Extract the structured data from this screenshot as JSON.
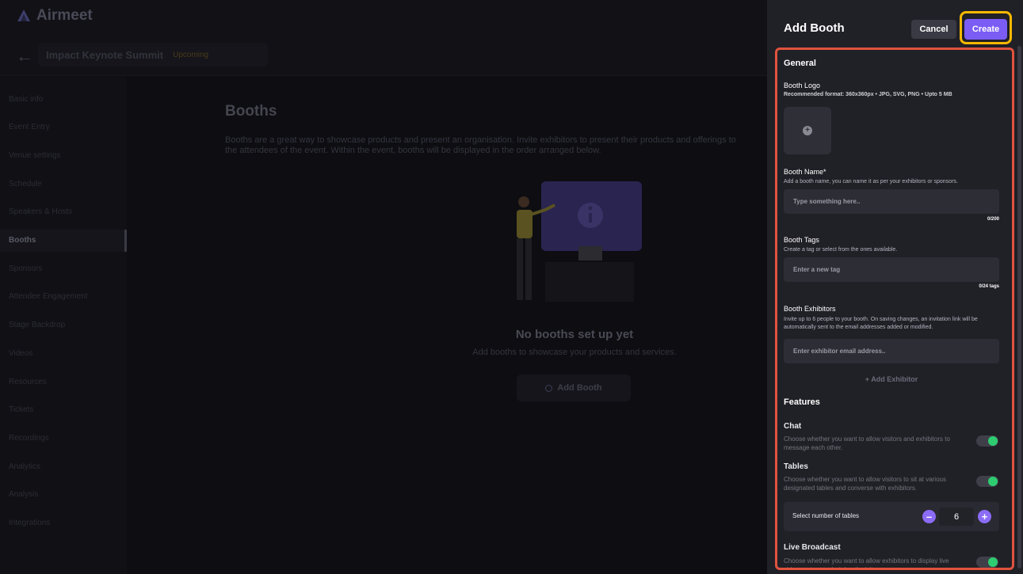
{
  "app": {
    "brand": "Airmeet",
    "event_name": "Impact Keynote Summit",
    "event_status": "Upcoming"
  },
  "sidebar": {
    "items": [
      {
        "label": "Basic info",
        "active": false
      },
      {
        "label": "Event Entry",
        "active": false
      },
      {
        "label": "Venue settings",
        "active": false
      },
      {
        "label": "Schedule",
        "active": false
      },
      {
        "label": "Speakers & Hosts",
        "active": false
      },
      {
        "label": "Booths",
        "active": true
      },
      {
        "label": "Sponsors",
        "active": false
      },
      {
        "label": "Attendee Engagement",
        "active": false
      },
      {
        "label": "Stage Backdrop",
        "active": false
      },
      {
        "label": "Videos",
        "active": false
      },
      {
        "label": "Resources",
        "active": false
      },
      {
        "label": "Tickets",
        "active": false
      },
      {
        "label": "Recordings",
        "active": false
      },
      {
        "label": "Analytics",
        "active": false
      },
      {
        "label": "Analysis",
        "active": false
      },
      {
        "label": "Integrations",
        "active": false
      }
    ]
  },
  "main": {
    "title": "Booths",
    "description": "Booths are a great way to showcase products and present an organisation. Invite exhibitors to present their products and offerings to the attendees of the event. Within the event, booths will be displayed in the order arranged below.",
    "empty_title": "No booths set up yet",
    "empty_subtitle": "Add booths to showcase your products and services.",
    "add_booth_label": "Add Booth"
  },
  "drawer": {
    "title": "Add Booth",
    "cancel_label": "Cancel",
    "create_label": "Create",
    "general": {
      "heading": "General",
      "logo_label": "Booth Logo",
      "logo_hint": "Recommended format: 360x360px • JPG, SVG, PNG • Upto 5 MB",
      "name_label": "Booth Name*",
      "name_hint": "Add a booth name, you can name it as per your exhibitors or sponsors.",
      "name_placeholder": "Type something here..",
      "name_counter": "0/200",
      "tags_label": "Booth Tags",
      "tags_hint": "Create a tag or select from the ones available.",
      "tags_placeholder": "Enter a new tag",
      "tags_counter": "0/24 tags",
      "exhibitors_label": "Booth Exhibitors",
      "exhibitors_hint": "Invite up to 6 people to your booth. On saving changes, an invitation link will be automatically sent to the email addresses added or modified.",
      "exhibitor_placeholder": "Enter exhibitor email address..",
      "add_exhibitor_label": "+ Add Exhibitor"
    },
    "features": {
      "heading": "Features",
      "chat_title": "Chat",
      "chat_desc": "Choose whether you want to allow visitors and exhibitors to message each other.",
      "chat_enabled": true,
      "tables_title": "Tables",
      "tables_desc": "Choose whether you want to allow visitors to sit at various designated tables and converse with exhibitors.",
      "tables_enabled": true,
      "tables_count_label": "Select number of tables",
      "tables_count": "6",
      "broadcast_title": "Live Broadcast",
      "broadcast_desc": "Choose whether you want to allow exhibitors to display live video content to their booth visitors.",
      "broadcast_enabled": true
    }
  },
  "colors": {
    "accent": "#7b5cf5",
    "toggle_on": "#2ecc71",
    "highlight_create": "#f5b800",
    "highlight_panel": "#e0533d"
  }
}
